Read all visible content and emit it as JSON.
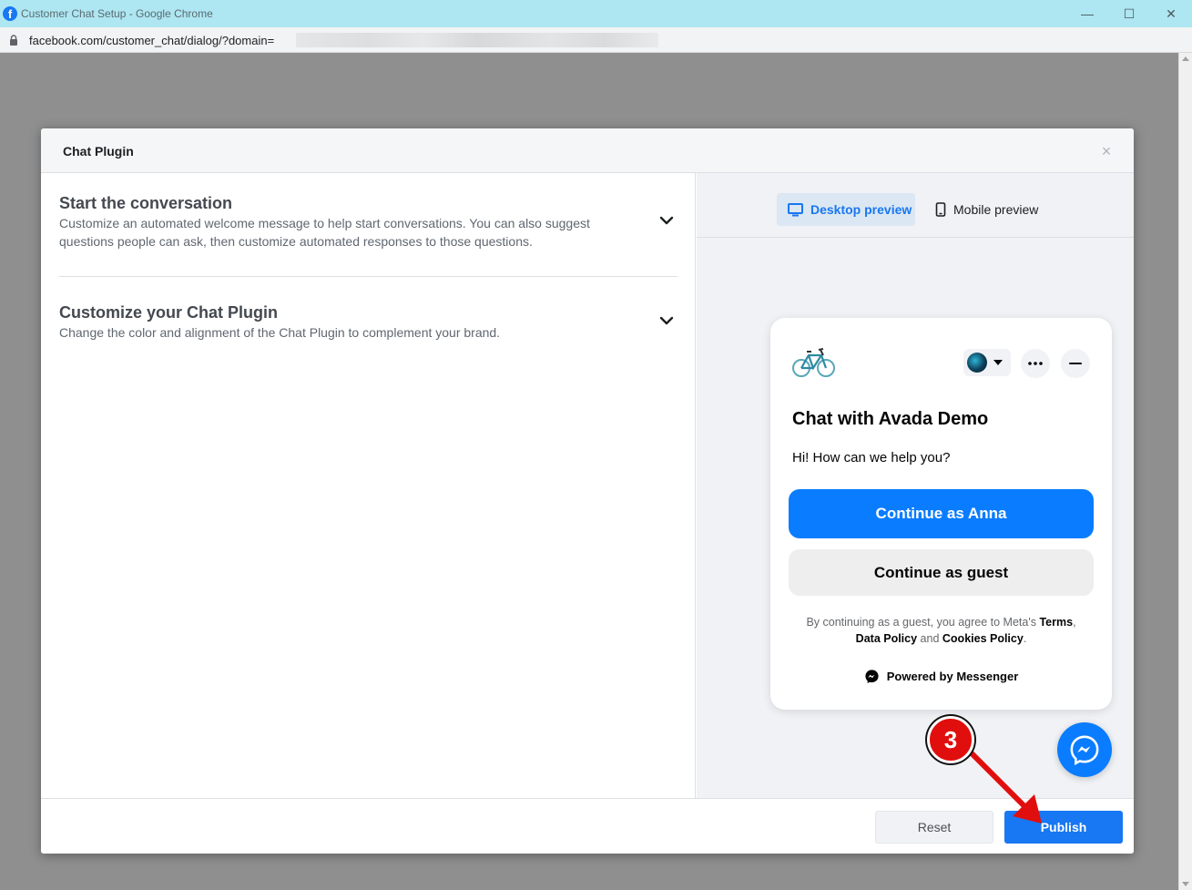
{
  "browser": {
    "window_title": "Customer Chat Setup - Google Chrome",
    "url": "facebook.com/customer_chat/dialog/?domain=",
    "favicon_letter": "f",
    "controls": {
      "minimize": "—",
      "maximize": "☐",
      "close": "✕"
    }
  },
  "dialog": {
    "title": "Chat Plugin",
    "close_symbol": "×",
    "sections": [
      {
        "title": "Start the conversation",
        "description": "Customize an automated welcome message to help start conversations. You can also suggest questions people can ask, then customize automated responses to those questions."
      },
      {
        "title": "Customize your Chat Plugin",
        "description": "Change the color and alignment of the Chat Plugin to complement your brand."
      }
    ],
    "preview_tabs": [
      {
        "label": "Desktop preview",
        "icon": "desktop-icon",
        "active": true
      },
      {
        "label": "Mobile preview",
        "icon": "mobile-icon",
        "active": false
      }
    ],
    "chat_preview": {
      "title": "Chat with Avada Demo",
      "greeting": "Hi! How can we help you?",
      "continue_as": "Continue as Anna",
      "continue_guest": "Continue as guest",
      "legal_prefix": "By continuing as a guest, you agree to Meta's",
      "terms": "Terms",
      "data_policy": "Data Policy",
      "and": "and",
      "cookies_policy": "Cookies Policy",
      "powered_by": "Powered by Messenger"
    },
    "footer": {
      "reset_label": "Reset",
      "publish_label": "Publish"
    }
  },
  "annotation": {
    "step_number": "3"
  },
  "colors": {
    "facebook_blue": "#1877f2",
    "messenger_blue": "#0a7cff",
    "annotation_red": "#e10e0e"
  }
}
